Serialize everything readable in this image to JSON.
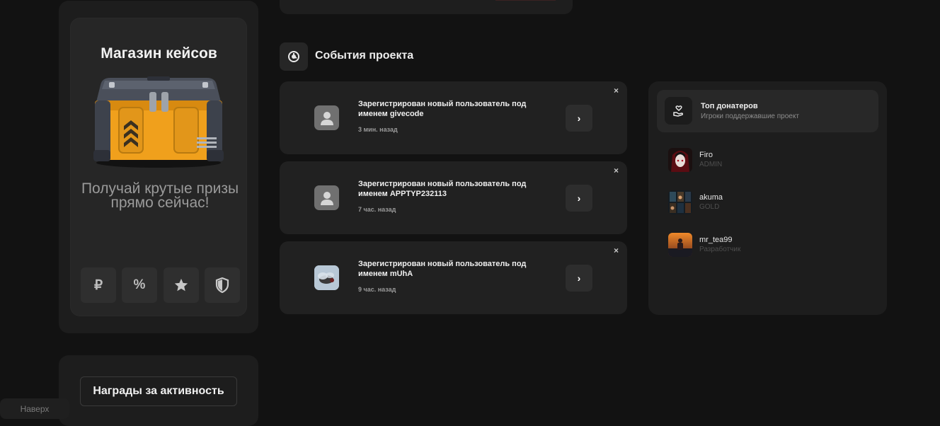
{
  "shop": {
    "title": "Магазин кейсов",
    "subtitle": "Получай крутые призы прямо сейчас!",
    "buttons": [
      {
        "label": "₽",
        "icon": "ruble-icon"
      },
      {
        "label": "%",
        "icon": "percent-icon"
      },
      {
        "label": "",
        "icon": "star-icon"
      },
      {
        "label": "",
        "icon": "shield-icon"
      }
    ]
  },
  "rewards": {
    "label": "Награды за активность"
  },
  "back_to_top": {
    "label": "Наверх"
  },
  "events": {
    "title": "События проекта",
    "items": [
      {
        "text": "Зарегистрирован новый пользователь под именем givecode",
        "time": "3 мин. назад",
        "avatar": "default-user-icon"
      },
      {
        "text": "Зарегистрирован новый пользователь под именем APPTYP232113",
        "time": "7 час. назад",
        "avatar": "default-user-icon"
      },
      {
        "text": "Зарегистрирован новый пользователь под именем mUhA",
        "time": "9 час. назад",
        "avatar": "custom-avatar"
      }
    ],
    "arrow_label": "›",
    "close_label": "×"
  },
  "donors": {
    "title": "Топ донатеров",
    "subtitle": "Игроки поддержавшие проект",
    "items": [
      {
        "name": "Firo",
        "role": "ADMIN"
      },
      {
        "name": "akuma",
        "role": "GOLD"
      },
      {
        "name": "mr_tea99",
        "role": "Разработчик"
      }
    ]
  },
  "colors": {
    "background": "#121212",
    "card": "#1d1d1d",
    "event_card": "#212121",
    "chest_orange": "#f0a01c"
  }
}
